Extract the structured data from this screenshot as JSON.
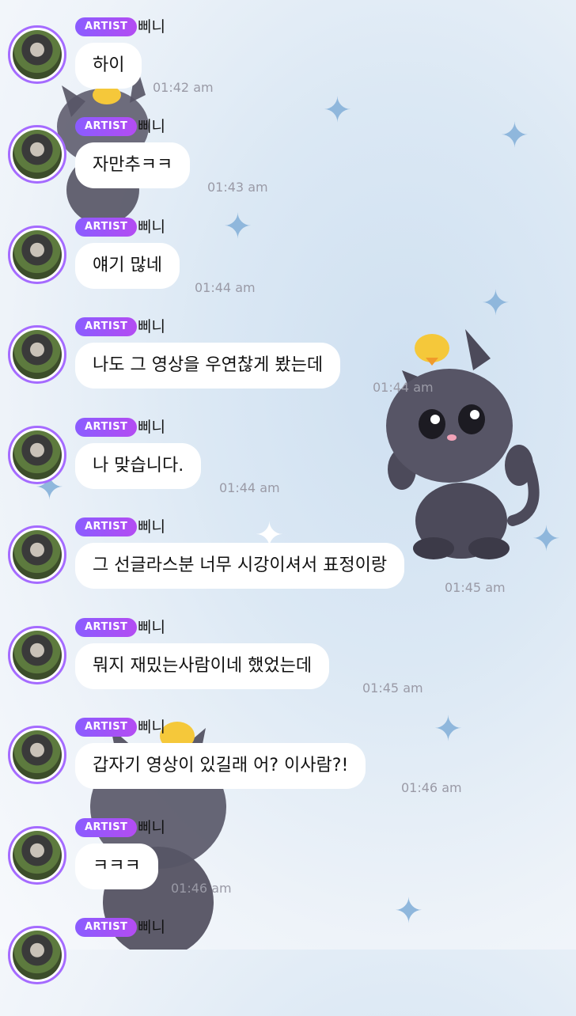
{
  "artist_badge": "ARTIST",
  "sender_name": "삐니",
  "messages": [
    {
      "text": "하이",
      "time": "01:42 am"
    },
    {
      "text": "자만추ㅋㅋ",
      "time": "01:43 am"
    },
    {
      "text": "얘기 많네",
      "time": "01:44 am"
    },
    {
      "text": "나도 그 영상을 우연찮게 봤는데",
      "time": "01:44 am"
    },
    {
      "text": "나 맞습니다.",
      "time": "01:44 am"
    },
    {
      "text": "그 선글라스분 너무 시강이셔서 표정이랑",
      "time": "01:45 am"
    },
    {
      "text": "뭐지 재밌는사람이네 했었는데",
      "time": "01:45 am"
    },
    {
      "text": "갑자기 영상이 있길래 어? 이사람?!",
      "time": "01:46 am"
    },
    {
      "text": "ㅋㅋㅋ",
      "time": "01:46 am"
    },
    {
      "text": "",
      "time": ""
    }
  ],
  "colors": {
    "badge_start": "#8a5cff",
    "badge_end": "#b44cf2",
    "avatar_ring": "#a56bff",
    "bubble": "#ffffff",
    "timestamp": "#9a9aa6",
    "sparkle": "#8fb7dc"
  }
}
